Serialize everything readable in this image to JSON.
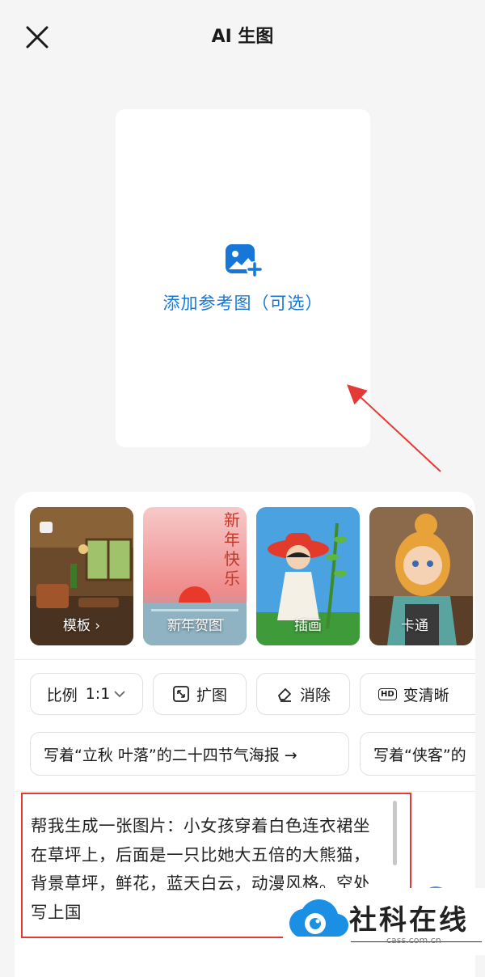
{
  "header": {
    "title": "AI 生图",
    "close_icon": "close-icon"
  },
  "upload": {
    "label": "添加参考图（可选）",
    "icon": "image-add-icon",
    "accent": "#1677d9"
  },
  "templates": [
    {
      "label": "模板 ›"
    },
    {
      "label": "新年贺图",
      "overlay_text": "新年快乐"
    },
    {
      "label": "插画"
    },
    {
      "label": "卡通"
    }
  ],
  "tools": {
    "ratio_label": "比例",
    "ratio_value": "1:1",
    "expand": "扩图",
    "erase": "消除",
    "enhance": "变清晰",
    "hd_badge": "HD"
  },
  "suggestions": [
    "写着“立秋 叶落”的二十四节气海报 →",
    "写着“侠客”的"
  ],
  "prompt": {
    "text": "帮我生成一张图片：小女孩穿着白色连衣裙坐在草坪上，后面是一只比她大五倍的大熊猫，背景草坪，鲜花，蓝天白云，动漫风格。空处写上国"
  },
  "annotation_color": "#e53935",
  "watermark": {
    "text": "社科在线",
    "url": "cass.com.cn"
  }
}
